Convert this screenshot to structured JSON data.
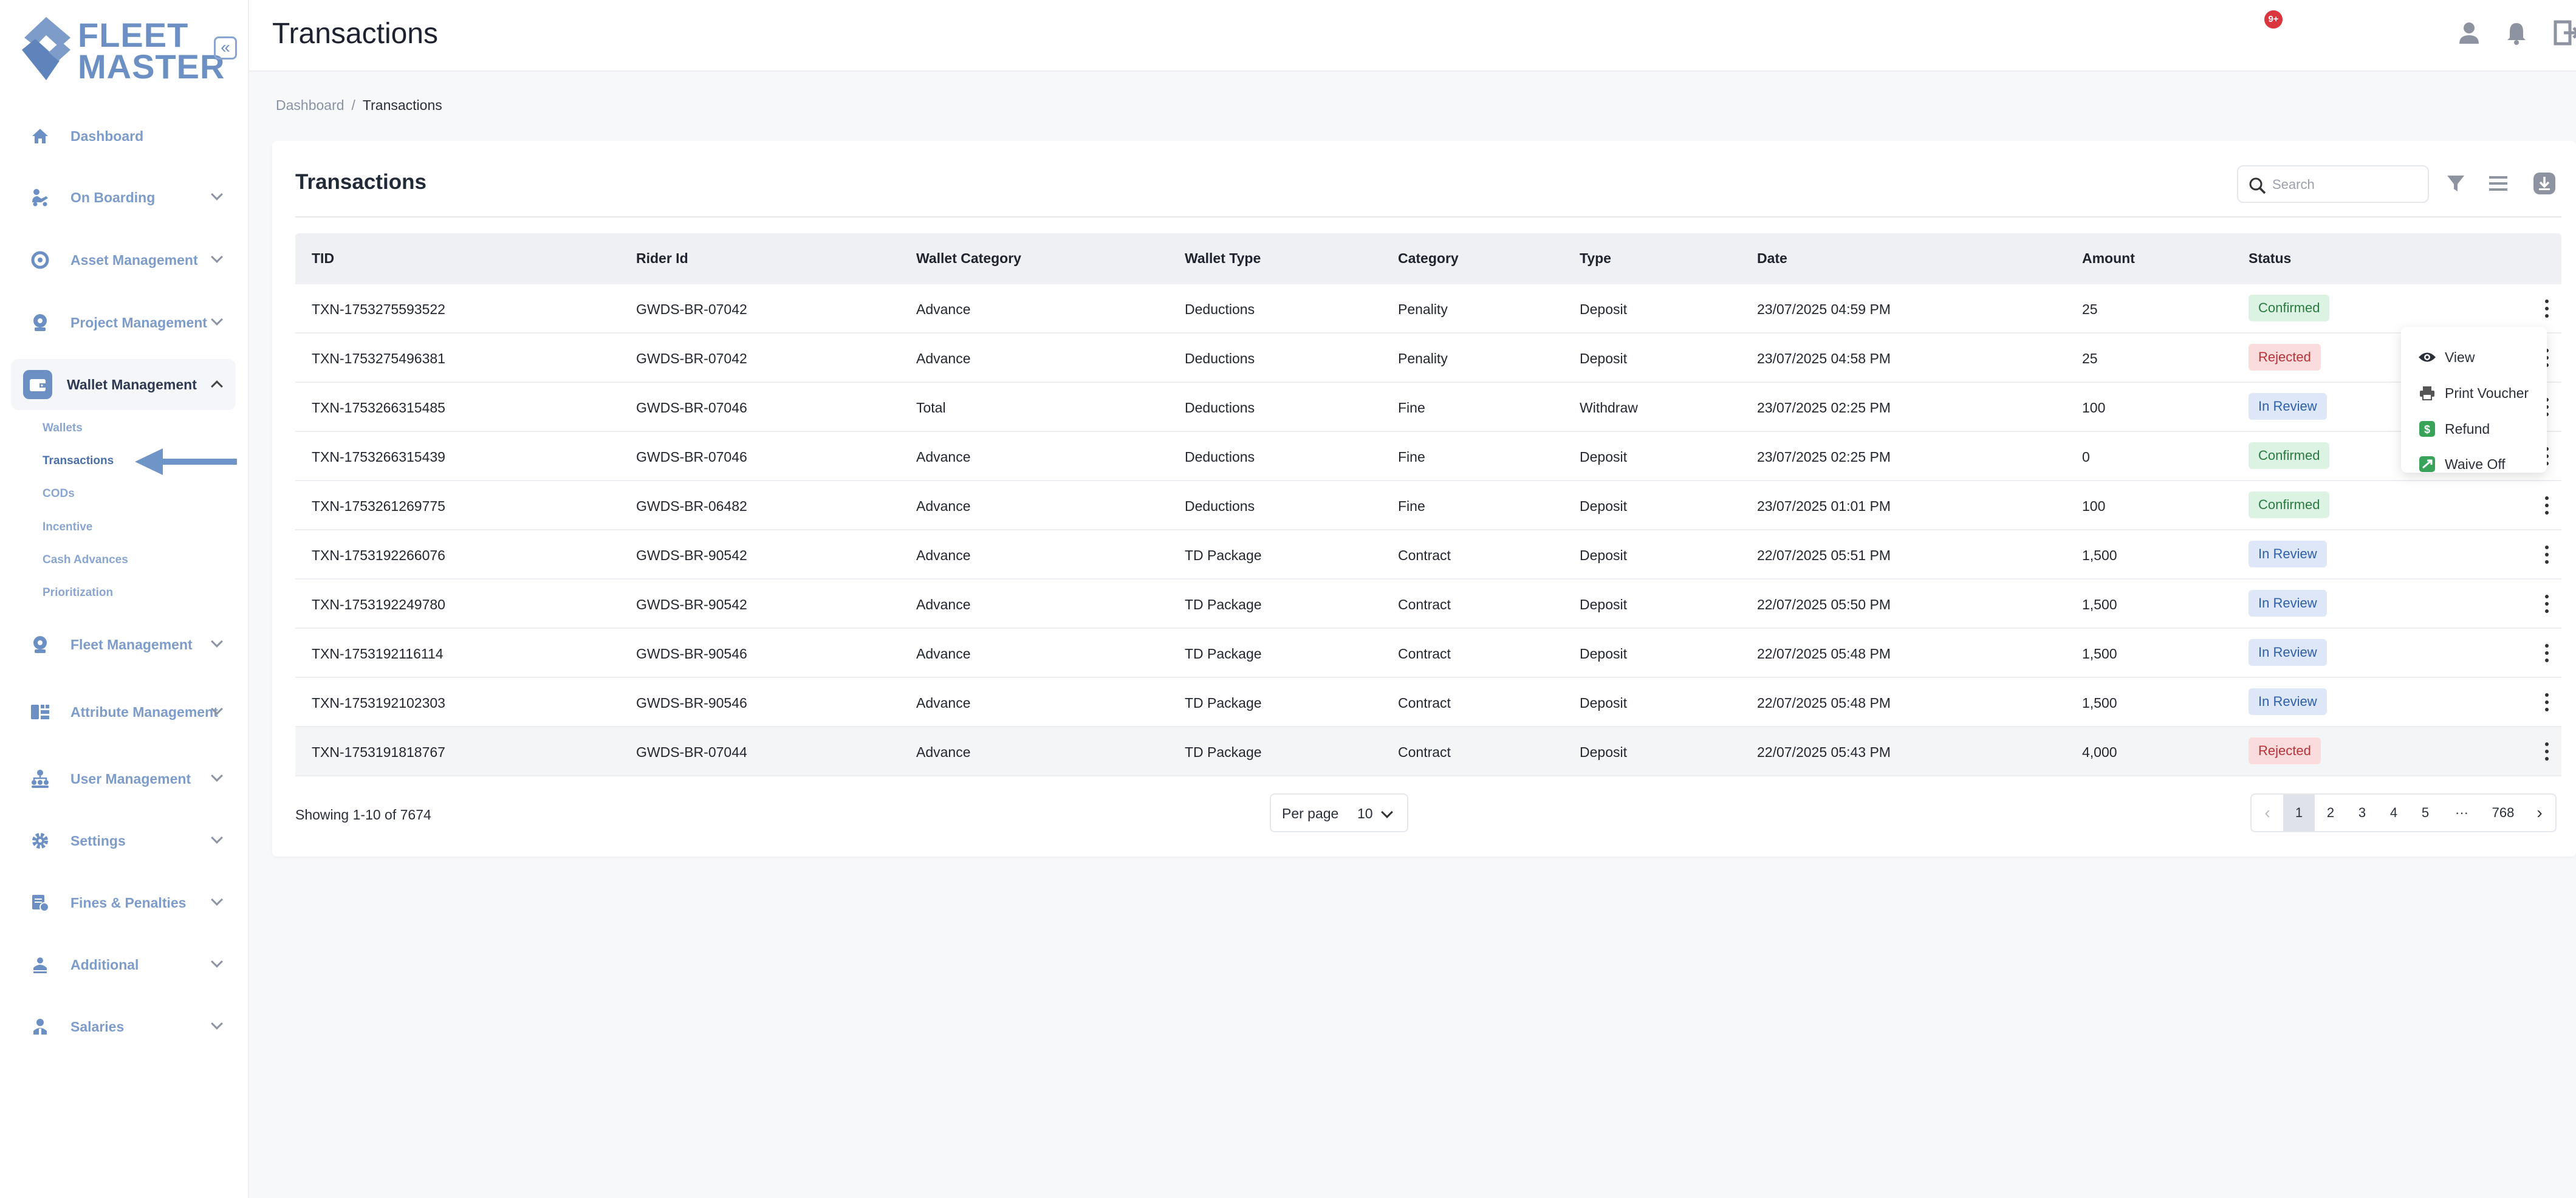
{
  "brand": {
    "line1": "FLEET",
    "line2": "MASTER",
    "collapse_glyph": "«"
  },
  "header": {
    "title": "Transactions",
    "notification_count": "9+"
  },
  "breadcrumb": {
    "root": "Dashboard",
    "separator": "/",
    "current": "Transactions"
  },
  "sidebar": {
    "items": [
      {
        "label": "Dashboard",
        "icon": "home-icon"
      },
      {
        "label": "On Boarding",
        "icon": "onboarding-icon"
      },
      {
        "label": "Asset Management",
        "icon": "asset-icon"
      },
      {
        "label": "Project Management",
        "icon": "project-icon"
      },
      {
        "label": "Wallet Management",
        "icon": "wallet-icon"
      },
      {
        "label": "Fleet Management",
        "icon": "fleet-icon"
      },
      {
        "label": "Attribute Management",
        "icon": "attribute-icon"
      },
      {
        "label": "User Management",
        "icon": "users-icon"
      },
      {
        "label": "Settings",
        "icon": "gear-icon"
      },
      {
        "label": "Fines & Penalties",
        "icon": "fines-icon"
      },
      {
        "label": "Additional",
        "icon": "additional-icon"
      },
      {
        "label": "Salaries",
        "icon": "salaries-icon"
      }
    ],
    "wallet_subitems": [
      "Wallets",
      "Transactions",
      "CODs",
      "Incentive",
      "Cash Advances",
      "Prioritization"
    ]
  },
  "card": {
    "title": "Transactions",
    "search_placeholder": "Search"
  },
  "table": {
    "columns": [
      "TID",
      "Rider Id",
      "Wallet Category",
      "Wallet Type",
      "Category",
      "Type",
      "Date",
      "Amount",
      "Status"
    ],
    "rows": [
      [
        "TXN-1753275593522",
        "GWDS-BR-07042",
        "Advance",
        "Deductions",
        "Penality",
        "Deposit",
        "23/07/2025 04:59 PM",
        "25",
        "Confirmed"
      ],
      [
        "TXN-1753275496381",
        "GWDS-BR-07042",
        "Advance",
        "Deductions",
        "Penality",
        "Deposit",
        "23/07/2025 04:58 PM",
        "25",
        "Rejected"
      ],
      [
        "TXN-1753266315485",
        "GWDS-BR-07046",
        "Total",
        "Deductions",
        "Fine",
        "Withdraw",
        "23/07/2025 02:25 PM",
        "100",
        "In Review"
      ],
      [
        "TXN-1753266315439",
        "GWDS-BR-07046",
        "Advance",
        "Deductions",
        "Fine",
        "Deposit",
        "23/07/2025 02:25 PM",
        "0",
        "Confirmed"
      ],
      [
        "TXN-1753261269775",
        "GWDS-BR-06482",
        "Advance",
        "Deductions",
        "Fine",
        "Deposit",
        "23/07/2025 01:01 PM",
        "100",
        "Confirmed"
      ],
      [
        "TXN-1753192266076",
        "GWDS-BR-90542",
        "Advance",
        "TD Package",
        "Contract",
        "Deposit",
        "22/07/2025 05:51 PM",
        "1,500",
        "In Review"
      ],
      [
        "TXN-1753192249780",
        "GWDS-BR-90542",
        "Advance",
        "TD Package",
        "Contract",
        "Deposit",
        "22/07/2025 05:50 PM",
        "1,500",
        "In Review"
      ],
      [
        "TXN-1753192116114",
        "GWDS-BR-90546",
        "Advance",
        "TD Package",
        "Contract",
        "Deposit",
        "22/07/2025 05:48 PM",
        "1,500",
        "In Review"
      ],
      [
        "TXN-1753192102303",
        "GWDS-BR-90546",
        "Advance",
        "TD Package",
        "Contract",
        "Deposit",
        "22/07/2025 05:48 PM",
        "1,500",
        "In Review"
      ],
      [
        "TXN-1753191818767",
        "GWDS-BR-07044",
        "Advance",
        "TD Package",
        "Contract",
        "Deposit",
        "22/07/2025 05:43 PM",
        "4,000",
        "Rejected"
      ]
    ]
  },
  "row_menu": {
    "items": [
      "View",
      "Print Voucher",
      "Refund",
      "Waive Off"
    ]
  },
  "footer": {
    "showing": "Showing 1-10 of 7674",
    "per_page_label": "Per page",
    "per_page_value": "10",
    "pages": [
      "1",
      "2",
      "3",
      "4",
      "5",
      "···",
      "768"
    ],
    "current_page": "1"
  },
  "colors": {
    "accent": "#6c8fc4",
    "confirmed": "#2a7a42",
    "rejected": "#b8323a",
    "in_review": "#2f5fa8"
  }
}
